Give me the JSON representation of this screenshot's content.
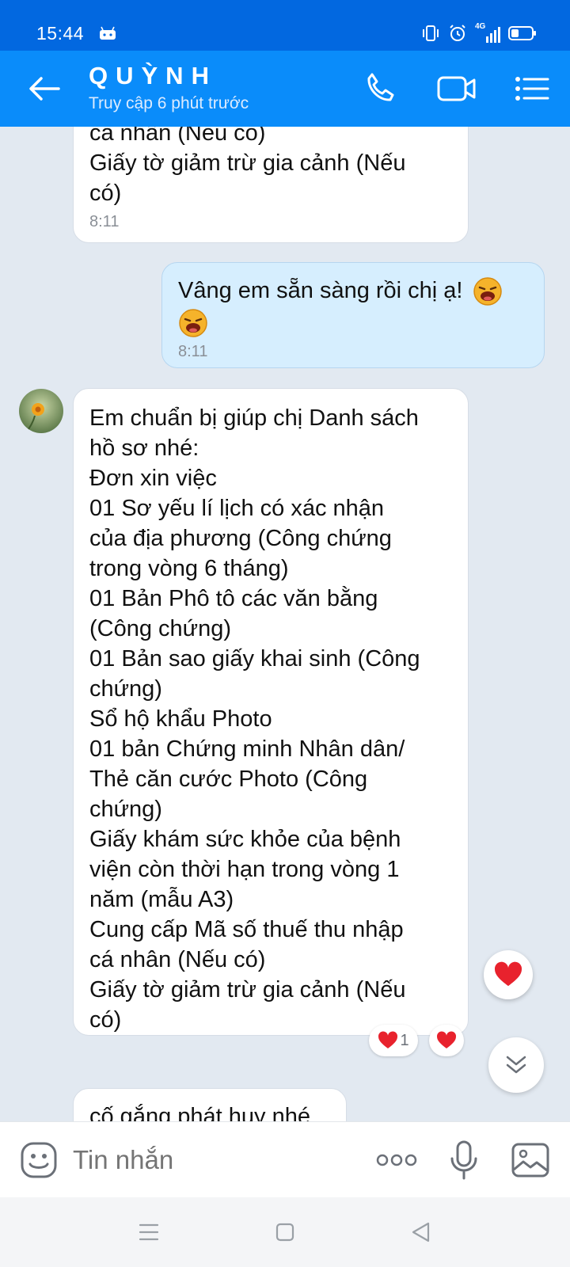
{
  "status_bar": {
    "time": "15:44",
    "network": "4G",
    "icons": [
      "android-icon",
      "vibrate-icon",
      "alarm-icon",
      "signal-icon",
      "battery-icon"
    ]
  },
  "header": {
    "contact_name": "QUỲNH",
    "contact_status": "Truy cập 6 phút trước",
    "icons": [
      "back-arrow-icon",
      "phone-icon",
      "video-call-icon",
      "menu-list-icon"
    ]
  },
  "messages": [
    {
      "direction": "incoming",
      "text": "cá nhân (Nếu có)\nGiấy tờ giảm trừ gia cảnh (Nếu\ncó)",
      "time": "8:11"
    },
    {
      "direction": "outgoing",
      "text": "Vâng em sẵn sàng rồi chị ạ!",
      "emoji": "laughing-sticker",
      "time": "8:11"
    },
    {
      "direction": "incoming",
      "text": "Em chuẩn bị giúp chị Danh sách\nhồ sơ nhé:\nĐơn xin việc\n01 Sơ yếu lí lịch có xác nhận\ncủa địa phương  (Công chứng\ntrong vòng 6 tháng)\n01 Bản Phô tô các văn bằng\n(Công chứng)\n01 Bản sao giấy khai sinh (Công\nchứng)\nSổ hộ khẩu Photo\n01 bản Chứng minh Nhân dân/\nThẻ căn cước Photo (Công\nchứng)\nGiấy khám sức khỏe của bệnh\nviện còn thời hạn trong vòng 1\nnăm (mẫu A3)\nCung cấp Mã số thuế thu nhập\ncá nhân (Nếu có)\nGiấy tờ giảm trừ gia cảnh (Nếu\ncó)",
      "reactions": {
        "heart_count": "1"
      }
    },
    {
      "direction": "incoming",
      "text": "cố gắng phát huy nhé"
    }
  ],
  "input": {
    "placeholder": "Tin nhắn"
  },
  "colors": {
    "status_bar": "#0268e0",
    "header": "#0a8cfa",
    "chat_bg": "#e2e9f1",
    "outgoing_bubble": "#d6eefe",
    "heart": "#e8222d"
  }
}
